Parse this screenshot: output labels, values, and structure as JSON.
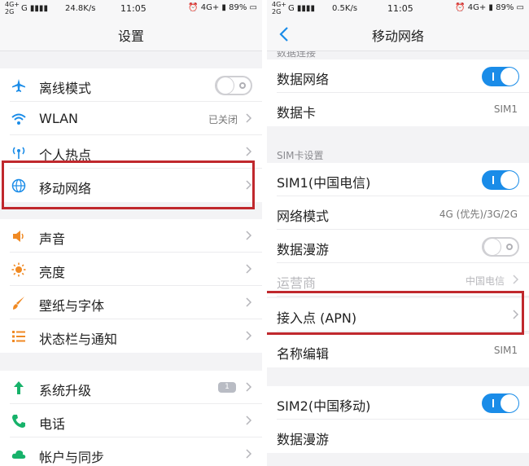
{
  "left": {
    "status": {
      "net_top": "4G+",
      "net_bottom": "2G",
      "carrier_sig": "G",
      "speed": "24.8K/s",
      "time": "11:05",
      "net_right": "4G+",
      "battery": "89%"
    },
    "title": "设置",
    "rows": [
      {
        "label": "离线模式"
      },
      {
        "label": "WLAN",
        "value": "已关闭"
      },
      {
        "label": "个人热点"
      },
      {
        "label": "移动网络"
      },
      {
        "label": "声音"
      },
      {
        "label": "亮度"
      },
      {
        "label": "壁纸与字体"
      },
      {
        "label": "状态栏与通知"
      },
      {
        "label": "系统升级",
        "badge": "1"
      },
      {
        "label": "电话"
      },
      {
        "label": "帐户与同步"
      }
    ]
  },
  "right": {
    "status": {
      "net_top": "4G+",
      "net_bottom": "2G",
      "carrier_sig": "G",
      "speed": "0.5K/s",
      "time": "11:05",
      "net_right": "4G+",
      "battery": "89%"
    },
    "title": "移动网络",
    "section_data": "数据连接",
    "section_sim": "SIM卡设置",
    "rows": [
      {
        "label": "数据网络"
      },
      {
        "label": "数据卡",
        "value": "SIM1"
      },
      {
        "label": "SIM1(中国电信)"
      },
      {
        "label": "网络模式",
        "value": "4G (优先)/3G/2G"
      },
      {
        "label": "数据漫游"
      },
      {
        "label": "运营商",
        "value": "中国电信"
      },
      {
        "label": "接入点 (APN)"
      },
      {
        "label": "名称编辑",
        "value": "SIM1"
      },
      {
        "label": "SIM2(中国移动)"
      },
      {
        "label": "数据漫游"
      }
    ]
  },
  "colors": {
    "accent": "#1a8ce8",
    "highlight": "#c0282d"
  }
}
